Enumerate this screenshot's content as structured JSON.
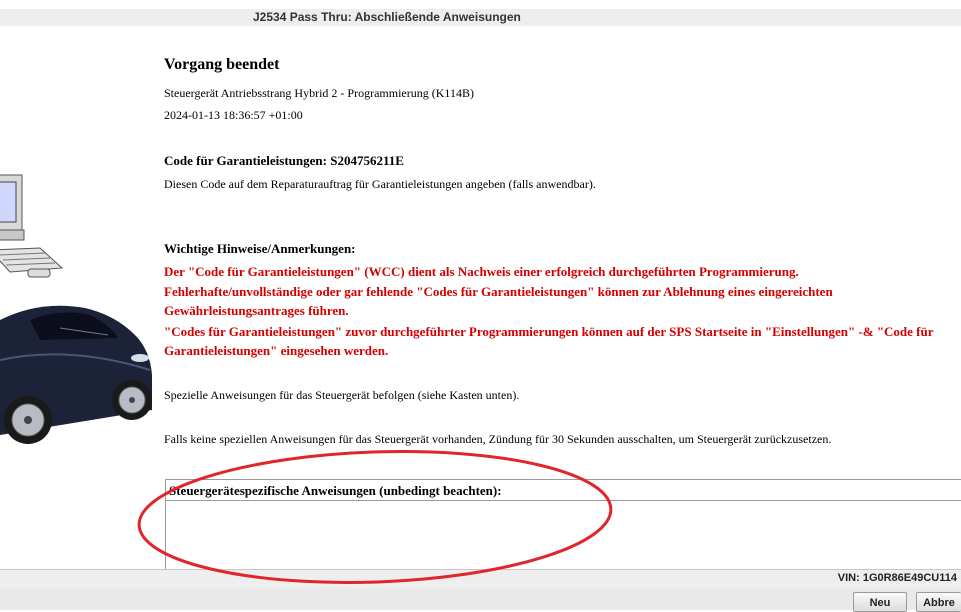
{
  "window": {
    "title": "J2534 Pass Thru:  Abschließende Anweisungen"
  },
  "content": {
    "heading": "Vorgang beendet",
    "module_line": "Steuergerät Antriebsstrang Hybrid 2 - Programmierung (K114B)",
    "timestamp": "2024-01-13 18:36:57 +01:00",
    "warranty_label": "Code für Garantieleistungen:",
    "warranty_code": "S204756211E",
    "warranty_hint": "Diesen Code auf dem Reparaturauftrag für Garantieleistungen angeben (falls anwendbar).",
    "notes_heading": "Wichtige Hinweise/Anmerkungen:",
    "notes_red_1": "Der \"Code für Garantieleistungen\" (WCC) dient als Nachweis einer erfolgreich durchgeführten Programmierung.",
    "notes_red_2": "Fehlerhafte/unvollständige oder gar fehlende \"Codes für Garantieleistungen\" können zur Ablehnung eines eingereichten Gewährleistungsantrages führen.",
    "notes_red_3": "\"Codes für Garantieleistungen\" zuvor durchgeführter Programmierungen können auf der SPS Startseite in \"Einstellungen\" -& \"Code für Garantieleistungen\" eingesehen werden.",
    "special_instructions": "Spezielle Anweisungen für das Steuergerät befolgen (siehe Kasten unten).",
    "fallback_instructions": "Falls keine speziellen Anweisungen für das Steuergerät vorhanden, Zündung für 30 Sekunden ausschalten, um Steuergerät zurückzusetzen."
  },
  "instructions_box": {
    "title": "Steuergerätespezifische Anweisungen (unbedingt beachten):",
    "body": ""
  },
  "status": {
    "vin": "VIN: 1G0R86E49CU114"
  },
  "buttons": {
    "new": "Neu",
    "cancel": "Abbre"
  },
  "colors": {
    "warning_text": "#d40000",
    "annotation_oval": "#e0262b",
    "car_body": "#1c2238"
  },
  "icons": {
    "illustration": "computer-and-car-illustration"
  }
}
